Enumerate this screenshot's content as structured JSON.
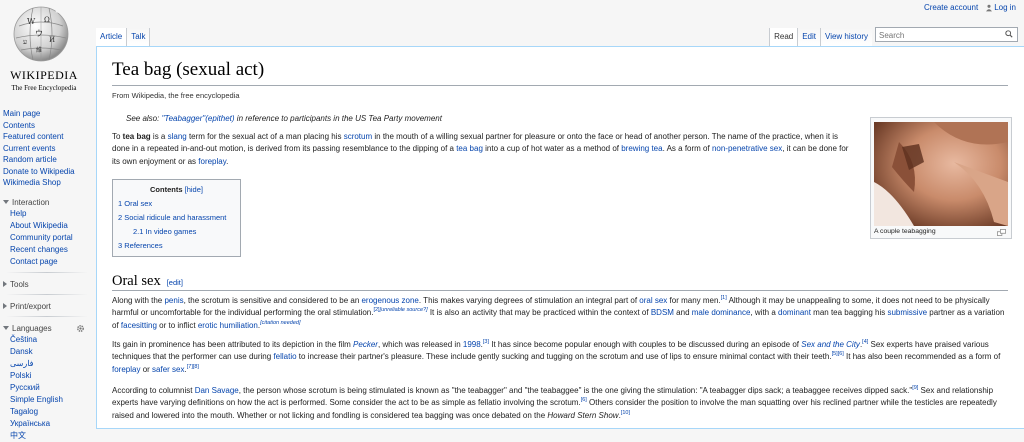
{
  "personal_tools": {
    "create_account": "Create account",
    "log_in": "Log in"
  },
  "logo": {
    "wordmark": "WIKIPEDIA",
    "tagline": "The Free Encyclopedia"
  },
  "tabs": {
    "article": "Article",
    "talk": "Talk",
    "read": "Read",
    "edit": "Edit",
    "view_history": "View history"
  },
  "search": {
    "placeholder": "Search"
  },
  "sidebar": {
    "nav": [
      "Main page",
      "Contents",
      "Featured content",
      "Current events",
      "Random article",
      "Donate to Wikipedia",
      "Wikimedia Shop"
    ],
    "interaction": {
      "heading": "Interaction",
      "items": [
        "Help",
        "About Wikipedia",
        "Community portal",
        "Recent changes",
        "Contact page"
      ]
    },
    "tools": "Tools",
    "printexport": "Print/export",
    "languages": {
      "heading": "Languages",
      "items": [
        "Čeština",
        "Dansk",
        "فارسی",
        "Polski",
        "Русский",
        "Simple English",
        "Tagalog",
        "Українська",
        "中文"
      ]
    }
  },
  "article": {
    "title": "Tea bag (sexual act)",
    "site_sub": "From Wikipedia, the free encyclopedia",
    "hatnote": {
      "prefix": "See also: ",
      "link": "\"Teabagger\"(epithet)",
      "suffix": " in reference to participants in the US Tea Party movement"
    },
    "intro": {
      "t1": "To ",
      "bold": "tea bag",
      "t2": " is a ",
      "l1": "slang",
      "t3": " term for the sexual act of a man placing his ",
      "l2": "scrotum",
      "t4": " in the mouth of a willing sexual partner for pleasure or onto the face or head of another person. The name of the practice, when it is done in a repeated in-and-out motion, is derived from its passing resemblance to the dipping of a ",
      "l3": "tea bag",
      "t5": " into a cup of hot water as a method of ",
      "l4": "brewing tea",
      "t6": ". As a form of ",
      "l5": "non-penetrative sex",
      "t7": ", it can be done for its own enjoyment or as ",
      "l6": "foreplay",
      "t8": "."
    },
    "toc": {
      "title": "Contents",
      "hide": "[hide]",
      "items": [
        "1 Oral sex",
        "2 Social ridicule and harassment",
        "2.1 In video games",
        "3 References"
      ]
    },
    "image_caption": "A couple teabagging",
    "section_oral": {
      "heading": "Oral sex",
      "edit": "[edit]"
    },
    "p1": {
      "t1": "Along with the ",
      "l1": "penis",
      "t2": ", the scrotum is sensitive and considered to be an ",
      "l2": "erogenous zone",
      "t3": ". This makes varying degrees of stimulation an integral part of ",
      "l3": "oral sex",
      "t4": " for many men.",
      "r1": "[1]",
      "t5": " Although it may be unappealing to some, it does not need to be physically harmful or uncomfortable for the individual performing the oral stimulation.",
      "r2": "[2]",
      "r2b": "[unreliable source?]",
      "t6": " It is also an activity that may be practiced within the context of ",
      "l4": "BDSM",
      "t7": " and ",
      "l5": "male dominance",
      "t8": ", with a ",
      "l6": "dominant",
      "t9": " man tea bagging his ",
      "l7": "submissive",
      "t10": " partner as a variation of ",
      "l8": "facesitting",
      "t11": " or to inflict ",
      "l9": "erotic humiliation",
      "t12": ".",
      "r3": "[citation needed]"
    },
    "p2": {
      "t1": "Its gain in prominence has been attributed to its depiction in the film ",
      "l1": "Pecker",
      "t2": ", which was released in ",
      "l2": "1998",
      "t3": ".",
      "r1": "[3]",
      "t4": " It has since become popular enough with couples to be discussed during an episode of ",
      "l3": "Sex and the City",
      "t5": ".",
      "r2": "[4]",
      "t6": " Sex experts have praised various techniques that the performer can use during ",
      "l4": "fellatio",
      "t7": " to increase their partner's pleasure. These include gently sucking and tugging on the scrotum and use of lips to ensure minimal contact with their teeth.",
      "r3": "[5][6]",
      "t8": " It has also been recommended as a form of ",
      "l5": "foreplay",
      "t9": " or ",
      "l6": "safer sex",
      "t10": ".",
      "r4": "[7][8]"
    },
    "p3": {
      "t1": "According to columnist ",
      "l1": "Dan Savage",
      "t2": ", the person whose scrotum is being stimulated is known as \"the teabagger\" and \"the teabaggee\" is the one giving the stimulation: \"A teabagger dips sack; a teabaggee receives dipped sack.\"",
      "r1": "[9]",
      "t3": " Sex and relationship experts have varying definitions on how the act is performed. Some consider the act to be as simple as fellatio involving the scrotum.",
      "r2": "[6]",
      "t4": " Others consider the position to involve the man squatting over his reclined partner while the testicles are repeatedly raised and lowered into the mouth. Whether or not licking and fondling is considered tea bagging was once debated on the ",
      "l2": "Howard Stern Show",
      "t5": ".",
      "r3": "[10]"
    }
  }
}
